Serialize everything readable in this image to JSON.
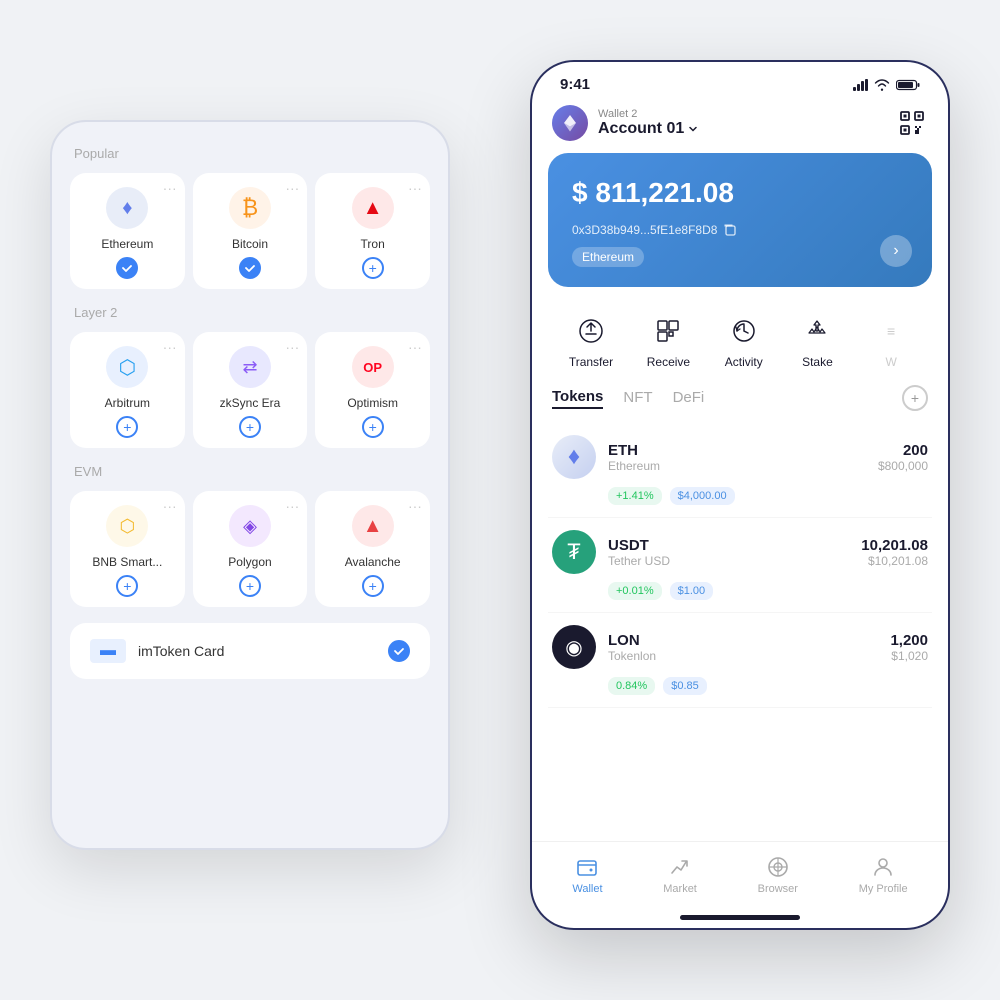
{
  "left_phone": {
    "sections": [
      {
        "title": "Popular",
        "networks": [
          {
            "name": "Ethereum",
            "icon": "♦",
            "bg": "eth-bg",
            "icon_color": "#627EEA",
            "status": "checked"
          },
          {
            "name": "Bitcoin",
            "icon": "₿",
            "bg": "btc-bg",
            "icon_color": "#F7931A",
            "status": "checked"
          },
          {
            "name": "Tron",
            "icon": "▲",
            "bg": "trx-bg",
            "icon_color": "#E50914",
            "status": "plus"
          }
        ]
      },
      {
        "title": "Layer 2",
        "networks": [
          {
            "name": "Arbitrum",
            "icon": "⬡",
            "bg": "arb-bg",
            "icon_color": "#28A0F0",
            "status": "plus"
          },
          {
            "name": "zkSync Era",
            "icon": "⇄",
            "bg": "zk-bg",
            "icon_color": "#8B5CF6",
            "status": "plus"
          },
          {
            "name": "Optimism",
            "icon": "OP",
            "bg": "op-bg",
            "icon_color": "#FF0420",
            "status": "plus"
          }
        ]
      },
      {
        "title": "EVM",
        "networks": [
          {
            "name": "BNB Smart...",
            "icon": "⬡",
            "bg": "bnb-bg",
            "icon_color": "#F3BA2F",
            "status": "plus"
          },
          {
            "name": "Polygon",
            "icon": "◈",
            "bg": "poly-bg",
            "icon_color": "#8247E5",
            "status": "plus"
          },
          {
            "name": "Avalanche",
            "icon": "▲",
            "bg": "avax-bg",
            "icon_color": "#E84142",
            "status": "plus"
          }
        ]
      }
    ],
    "imtoken_card": {
      "label": "imToken Card",
      "status": "checked"
    }
  },
  "right_phone": {
    "status_bar": {
      "time": "9:41",
      "battery": "🔋"
    },
    "header": {
      "wallet_label": "Wallet 2",
      "account_name": "Account 01"
    },
    "balance": {
      "amount": "$ 811,221.08",
      "address": "0x3D38b949...5fE1e8F8D8",
      "chain": "Ethereum"
    },
    "actions": [
      {
        "label": "Transfer",
        "icon": "↑"
      },
      {
        "label": "Receive",
        "icon": "⊞"
      },
      {
        "label": "Activity",
        "icon": "⟳"
      },
      {
        "label": "Stake",
        "icon": "◇"
      },
      {
        "label": "W",
        "icon": "≡"
      }
    ],
    "tabs": [
      {
        "label": "Tokens",
        "active": true
      },
      {
        "label": "NFT",
        "active": false
      },
      {
        "label": "DeFi",
        "active": false
      }
    ],
    "tokens": [
      {
        "symbol": "ETH",
        "name": "Ethereum",
        "amount": "200",
        "value": "$800,000",
        "change": "+1.41%",
        "price": "$4,000.00",
        "logo_bg": "eth-logo-bg",
        "logo_text": "♦",
        "logo_color": "#627EEA"
      },
      {
        "symbol": "USDT",
        "name": "Tether USD",
        "amount": "10,201.08",
        "value": "$10,201.08",
        "change": "+0.01%",
        "price": "$1.00",
        "logo_bg": "usdt-logo-bg",
        "logo_text": "₮",
        "logo_color": "#fff"
      },
      {
        "symbol": "LON",
        "name": "Tokenlon",
        "amount": "1,200",
        "value": "$1,020",
        "change": "0.84%",
        "price": "$0.85",
        "logo_bg": "lon-logo-bg",
        "logo_text": "◉",
        "logo_color": "#fff"
      }
    ],
    "bottom_nav": [
      {
        "label": "Wallet",
        "icon": "⬡",
        "active": true
      },
      {
        "label": "Market",
        "icon": "↗",
        "active": false
      },
      {
        "label": "Browser",
        "icon": "◎",
        "active": false
      },
      {
        "label": "My Profile",
        "icon": "👤",
        "active": false
      }
    ]
  }
}
